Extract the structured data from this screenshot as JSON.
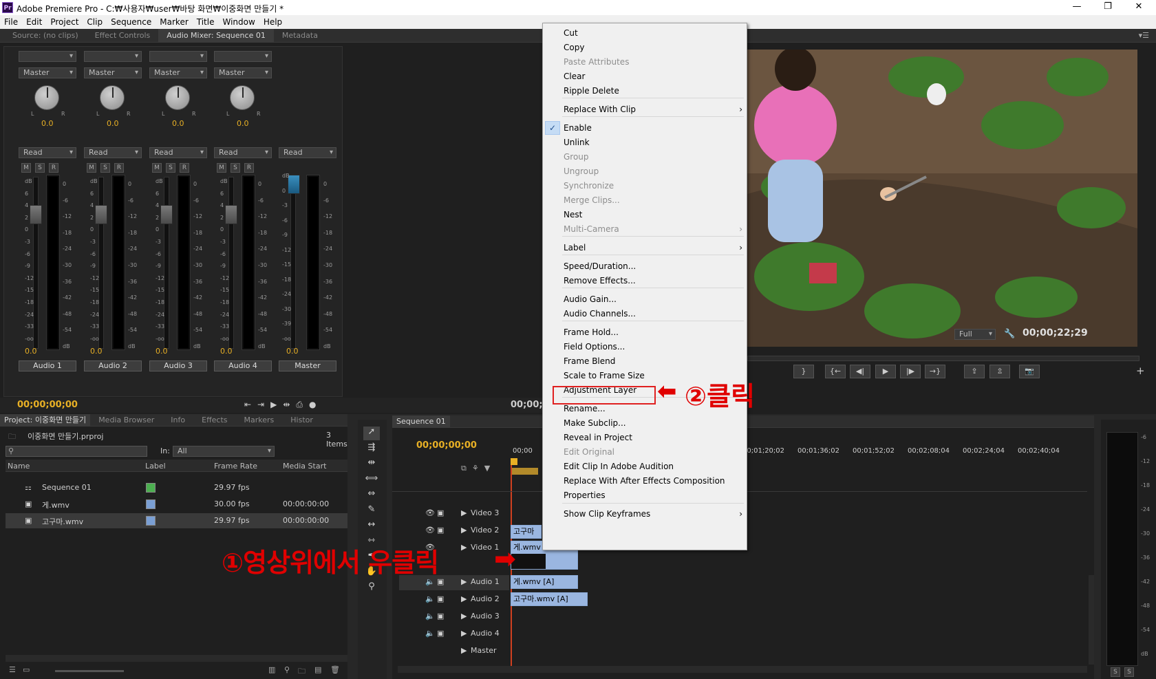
{
  "window": {
    "title": "Adobe Premiere Pro - C:₩사용자₩user₩바탕 화면₩이중화면 만들기 *",
    "app_icon": "Pr",
    "min": "—",
    "max": "❐",
    "close": "✕"
  },
  "menu": [
    "File",
    "Edit",
    "Project",
    "Clip",
    "Sequence",
    "Marker",
    "Title",
    "Window",
    "Help"
  ],
  "top_tabs": [
    "Source: (no clips)",
    "Effect Controls",
    "Audio Mixer: Sequence 01",
    "Metadata"
  ],
  "mixer": {
    "channels": [
      {
        "name": "Audio 1",
        "output": "Master",
        "pan": "0.0",
        "mode": "Read",
        "level": "0.0"
      },
      {
        "name": "Audio 2",
        "output": "Master",
        "pan": "0.0",
        "mode": "Read",
        "level": "0.0"
      },
      {
        "name": "Audio 3",
        "output": "Master",
        "pan": "0.0",
        "mode": "Read",
        "level": "0.0"
      },
      {
        "name": "Audio 4",
        "output": "Master",
        "pan": "0.0",
        "mode": "Read",
        "level": "0.0"
      }
    ],
    "master": {
      "name": "Master",
      "mode": "Read",
      "level": "0.0"
    },
    "fader_scale": [
      "dB",
      "6",
      "4",
      "2",
      "0",
      "-3",
      "-6",
      "-9",
      "-12",
      "-15",
      "-18",
      "-24",
      "-33",
      "-oo"
    ],
    "meter_scale": [
      "0",
      "-6",
      "-12",
      "-18",
      "-24",
      "-30",
      "-36",
      "-42",
      "-48",
      "-54",
      "dB"
    ],
    "master_fader_scale": [
      "dB",
      "0",
      "-3",
      "-6",
      "-9",
      "-12",
      "-15",
      "-18",
      "-24",
      "-30",
      "-39",
      "-oo"
    ],
    "msr": [
      "M",
      "S",
      "R"
    ],
    "pan_l": "L",
    "pan_r": "R",
    "timecode": "00;00;00;00",
    "timecode2": "00;00;"
  },
  "program": {
    "quality": "Full",
    "timecode": "00;00;22;29"
  },
  "context_menu": {
    "items": [
      {
        "label": "Cut",
        "enabled": true
      },
      {
        "label": "Copy",
        "enabled": true
      },
      {
        "label": "Paste Attributes",
        "enabled": false
      },
      {
        "label": "Clear",
        "enabled": true
      },
      {
        "label": "Ripple Delete",
        "enabled": true
      },
      {
        "label": "Replace With Clip",
        "enabled": true,
        "submenu": true
      },
      {
        "label": "Enable",
        "enabled": true,
        "checked": true
      },
      {
        "label": "Unlink",
        "enabled": true
      },
      {
        "label": "Group",
        "enabled": false
      },
      {
        "label": "Ungroup",
        "enabled": false
      },
      {
        "label": "Synchronize",
        "enabled": false
      },
      {
        "label": "Merge Clips...",
        "enabled": false
      },
      {
        "label": "Nest",
        "enabled": true
      },
      {
        "label": "Multi-Camera",
        "enabled": false,
        "submenu": true
      },
      {
        "label": "Label",
        "enabled": true,
        "submenu": true
      },
      {
        "label": "Speed/Duration...",
        "enabled": true
      },
      {
        "label": "Remove Effects...",
        "enabled": true
      },
      {
        "label": "Audio Gain...",
        "enabled": true
      },
      {
        "label": "Audio Channels...",
        "enabled": true
      },
      {
        "label": "Frame Hold...",
        "enabled": true
      },
      {
        "label": "Field Options...",
        "enabled": true
      },
      {
        "label": "Frame Blend",
        "enabled": true
      },
      {
        "label": "Scale to Frame Size",
        "enabled": true
      },
      {
        "label": "Adjustment Layer",
        "enabled": true
      },
      {
        "label": "Rename...",
        "enabled": true
      },
      {
        "label": "Make Subclip...",
        "enabled": true
      },
      {
        "label": "Reveal in Project",
        "enabled": true
      },
      {
        "label": "Edit Original",
        "enabled": false
      },
      {
        "label": "Edit Clip In Adobe Audition",
        "enabled": true
      },
      {
        "label": "Replace With After Effects Composition",
        "enabled": true
      },
      {
        "label": "Properties",
        "enabled": true
      },
      {
        "label": "Show Clip Keyframes",
        "enabled": true,
        "submenu": true
      }
    ],
    "submenu_arrow": "›",
    "check": "✓"
  },
  "annotations": {
    "step1": "①영상위에서 우클릭",
    "step2": "②클릭"
  },
  "project": {
    "tabs": [
      "Project: 이중화면 만들기",
      "Media Browser",
      "Info",
      "Effects",
      "Markers",
      "Histor"
    ],
    "filename": "이중화면 만들기.prproj",
    "count": "3 Items",
    "in_label": "In:",
    "in_value": "All",
    "columns": [
      "Name",
      "Label",
      "Frame Rate",
      "Media Start"
    ],
    "rows": [
      {
        "name": "Sequence 01",
        "label_color": "#4caf50",
        "fps": "29.97 fps",
        "start": ""
      },
      {
        "name": "게.wmv",
        "label_color": "#7a9fd4",
        "fps": "30.00 fps",
        "start": "00:00:00:00"
      },
      {
        "name": "고구마.wmv",
        "label_color": "#7a9fd4",
        "fps": "29.97 fps",
        "start": "00:00:00:00"
      }
    ]
  },
  "timeline": {
    "tab": "Sequence 01",
    "timecode": "00;00;00;00",
    "ruler": [
      "00;00",
      "00;01;20;02",
      "00;01;36;02",
      "00;01;52;02",
      "00;02;08;04",
      "00;02;24;04",
      "00;02;40;04"
    ],
    "ruler_partial": "2",
    "tracks": [
      "Video 3",
      "Video 2",
      "Video 1",
      "Audio 1",
      "Audio 2",
      "Audio 3",
      "Audio 4",
      "Master"
    ],
    "clips": {
      "v2": "고구마",
      "v1": "게.wmv",
      "a1": "게.wmv [A]",
      "a2": "고구마.wmv [A]"
    }
  },
  "right_meter_scale": [
    "-6",
    "-12",
    "-18",
    "-24",
    "-30",
    "-36",
    "-42",
    "-48",
    "-54",
    "dB"
  ],
  "right_meter_buttons": [
    "S",
    "S"
  ],
  "colors": {
    "accent_orange": "#e8b025",
    "annotation_red": "#e00000",
    "clip_blue": "#9ab6e0"
  }
}
